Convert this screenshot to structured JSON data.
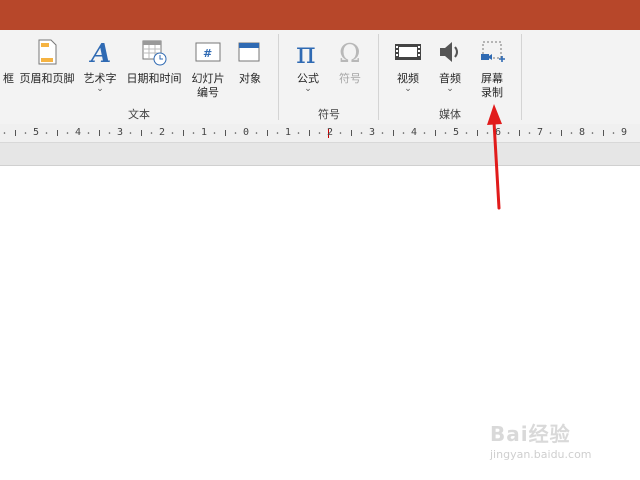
{
  "ribbon": {
    "text_box_partial": "框",
    "header_footer": "页眉和页脚",
    "wordart": "艺术字",
    "wordart_chevron": "⌄",
    "datetime": "日期和时间",
    "slide_number_line1": "幻灯片",
    "slide_number_line2": "编号",
    "object": "对象",
    "group_text": "文本",
    "equation": "公式",
    "equation_chevron": "⌄",
    "symbol": "符号",
    "group_symbols": "符号",
    "video": "视频",
    "video_chevron": "⌄",
    "audio": "音频",
    "audio_chevron": "⌄",
    "screen_rec_line1": "屏幕",
    "screen_rec_line2": "录制",
    "group_media": "媒体"
  },
  "ruler": {
    "ticks": [
      "5",
      "4",
      "3",
      "2",
      "1",
      "0",
      "1",
      "2",
      "3",
      "4",
      "5",
      "6",
      "7",
      "8",
      "9"
    ]
  },
  "watermark": {
    "brand": "Bai经验",
    "url": "jingyan.baidu.com"
  },
  "colors": {
    "titlebar": "#b7472a",
    "accent_blue": "#2f6ab3",
    "arrow_red": "#e11b1b"
  }
}
